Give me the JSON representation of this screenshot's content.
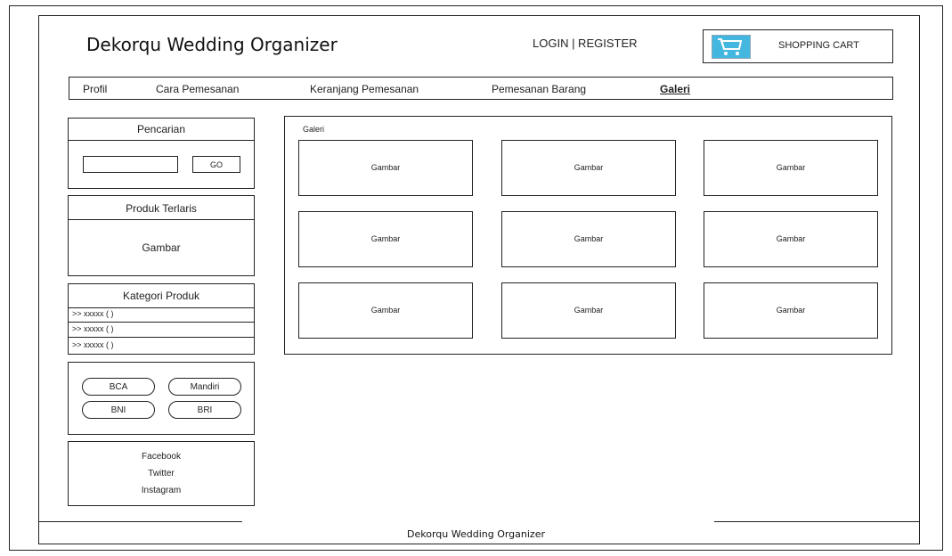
{
  "header": {
    "site_title": "Dekorqu Wedding Organizer",
    "login_register": "LOGIN | REGISTER",
    "cart_label": "SHOPPING CART",
    "cart_icon": "shopping-cart-icon",
    "cart_icon_color": "#43b7e0"
  },
  "nav": {
    "items": [
      {
        "label": "Profil"
      },
      {
        "label": "Cara Pemesanan"
      },
      {
        "label": "Keranjang Pemesanan"
      },
      {
        "label": "Pemesanan Barang"
      },
      {
        "label": "Galeri",
        "active": true
      }
    ]
  },
  "sidebar": {
    "search": {
      "title": "Pencarian",
      "input_value": "",
      "go_label": "GO"
    },
    "best_seller": {
      "title": "Produk Terlaris",
      "image_label": "Gambar"
    },
    "categories": {
      "title": "Kategori Produk",
      "items": [
        ">> xxxxx ( )",
        ">> xxxxx ( )",
        ">> xxxxx ( )"
      ]
    },
    "banks": [
      "BCA",
      "Mandiri",
      "BNI",
      "BRI"
    ],
    "social": [
      "Facebook",
      "Twitter",
      "Instagram"
    ]
  },
  "gallery": {
    "title": "Galeri",
    "cells": [
      "Gambar",
      "Gambar",
      "Gambar",
      "Gambar",
      "Gambar",
      "Gambar",
      "Gambar",
      "Gambar",
      "Gambar"
    ]
  },
  "footer": {
    "text": "Dekorqu Wedding Organizer"
  }
}
